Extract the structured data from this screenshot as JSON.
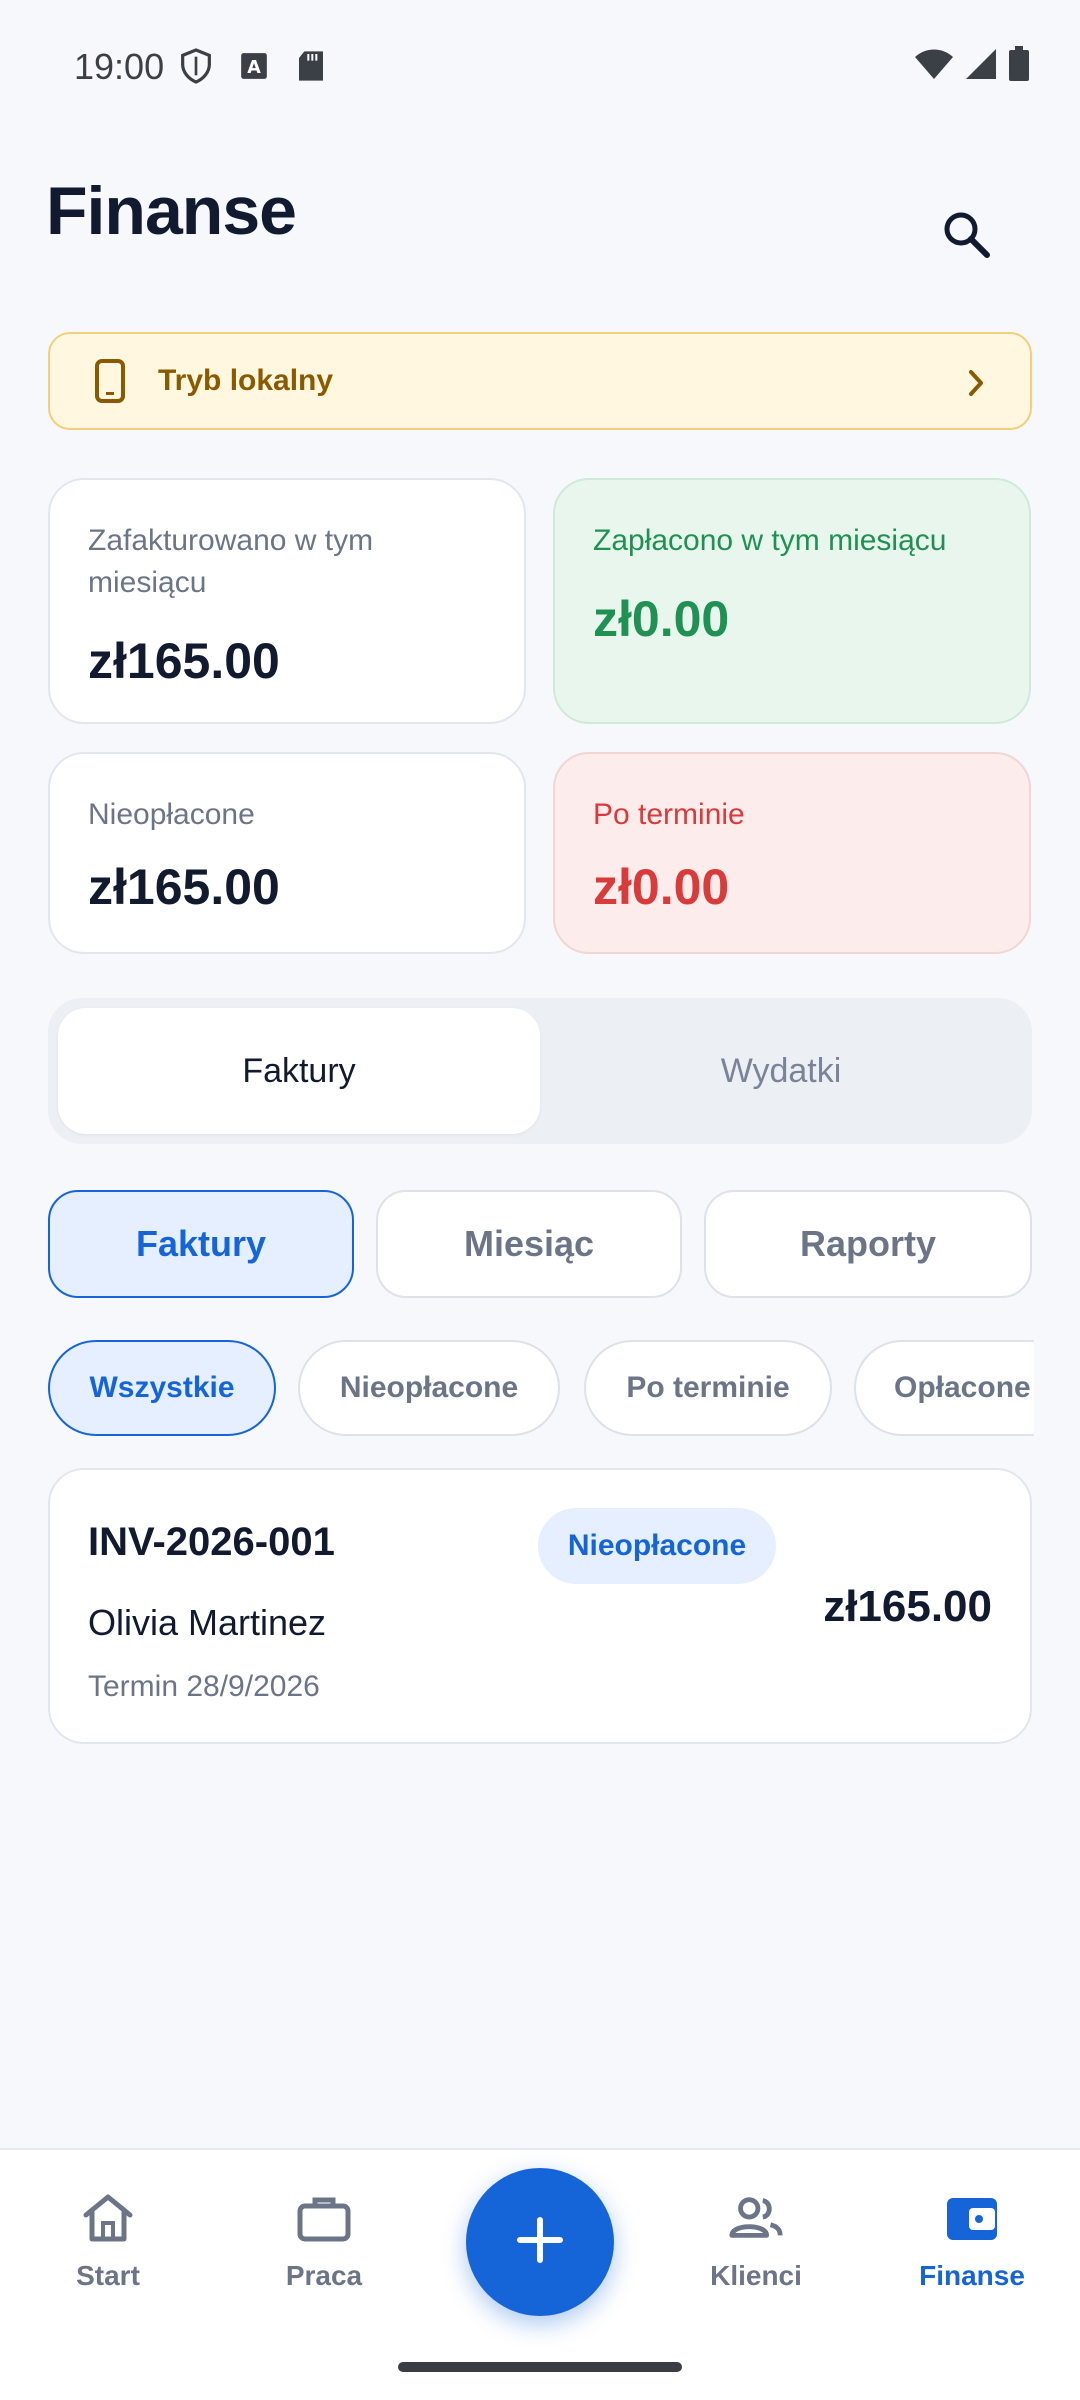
{
  "status_bar": {
    "time": "19:00"
  },
  "header": {
    "title": "Finanse"
  },
  "local_banner": {
    "label": "Tryb lokalny"
  },
  "stats": {
    "invoiced": {
      "label": "Zafakturowano w tym miesiącu",
      "value": "zł165.00"
    },
    "paid": {
      "label": "Zapłacono w tym miesiącu",
      "value": "zł0.00"
    },
    "unpaid": {
      "label": "Nieopłacone",
      "value": "zł165.00"
    },
    "overdue": {
      "label": "Po terminie",
      "value": "zł0.00"
    }
  },
  "segmented": {
    "items": [
      "Faktury",
      "Wydatki"
    ],
    "selected": "Faktury"
  },
  "subtabs": {
    "items": [
      "Faktury",
      "Miesiąc",
      "Raporty"
    ],
    "selected": "Faktury"
  },
  "filter_chips": {
    "items": [
      "Wszystkie",
      "Nieopłacone",
      "Po terminie",
      "Opłacone"
    ],
    "selected": "Wszystkie"
  },
  "invoices": [
    {
      "number": "INV-2026-001",
      "status": "Nieopłacone",
      "client": "Olivia Martinez",
      "due": "Termin 28/9/2026",
      "amount": "zł165.00"
    }
  ],
  "bottom_nav": {
    "items": [
      "Start",
      "Praca",
      "Klienci",
      "Finanse"
    ],
    "active": "Finanse"
  },
  "colors": {
    "primary": "#1565d8",
    "paid_green": "#1f9152",
    "overdue_red": "#d93a3a",
    "banner_amber": "#8a5a00"
  },
  "icons": {
    "search": "search-icon",
    "banner": "phone-icon",
    "fab": "plus-icon",
    "nav": [
      "home-icon",
      "briefcase-icon",
      "people-icon",
      "wallet-icon"
    ]
  }
}
